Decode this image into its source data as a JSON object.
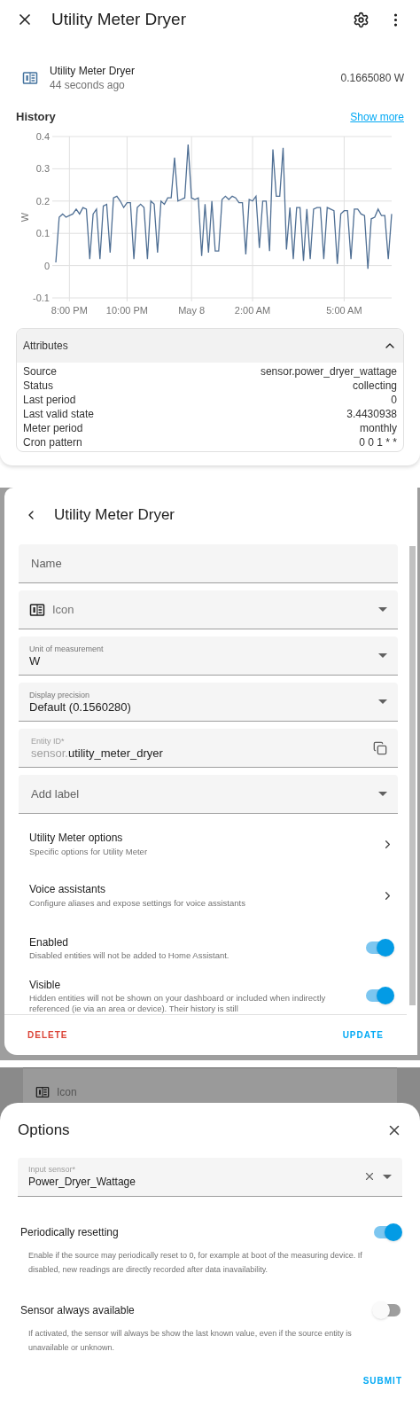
{
  "more_info": {
    "title": "Utility Meter Dryer",
    "entity": {
      "name": "Utility Meter Dryer",
      "last_changed": "44 seconds ago",
      "state": "0.1665080 W"
    },
    "history": {
      "title": "History",
      "show_more": "Show more",
      "chart_data": {
        "type": "line",
        "grid": true,
        "ylabel": "W",
        "ylim": [
          -0.1,
          0.4
        ],
        "yticks": [
          -0.1,
          0,
          0.1,
          0.2,
          0.3,
          0.4
        ],
        "categories": [
          null,
          null,
          null,
          null,
          "8:00 PM",
          null,
          null,
          null,
          null,
          null,
          null,
          null,
          null,
          null,
          null,
          null,
          null,
          null,
          null,
          null,
          null,
          "10:00 PM",
          null,
          null,
          null,
          null,
          null,
          null,
          null,
          null,
          null,
          null,
          null,
          null,
          null,
          null,
          null,
          null,
          null,
          null,
          "May 8",
          null,
          null,
          null,
          null,
          null,
          null,
          null,
          null,
          null,
          null,
          null,
          null,
          null,
          null,
          null,
          null,
          null,
          "2:00 AM",
          null,
          null,
          null,
          null,
          null,
          null,
          null,
          null,
          null,
          null,
          null,
          null,
          null,
          null,
          null,
          null,
          null,
          null,
          null,
          null,
          null,
          null,
          null,
          null,
          null,
          null,
          "5:00 AM",
          null,
          null,
          null,
          null,
          null,
          null,
          null,
          null,
          null,
          null,
          null,
          null,
          null,
          null
        ],
        "series": [
          {
            "color": "#4f6f94",
            "values": [
              0.01,
              0.15,
              0.16,
              0.15,
              0.155,
              0.16,
              0.175,
              0.16,
              0.18,
              0.175,
              0.02,
              0.16,
              0.175,
              0.02,
              0.185,
              0.19,
              0.04,
              0.21,
              0.215,
              0.2,
              0.18,
              0.195,
              0.195,
              0.02,
              0.18,
              0.19,
              0.18,
              0.02,
              0.2,
              0.19,
              0.04,
              0.2,
              0.19,
              0.21,
              0.21,
              0.335,
              0.2,
              0.205,
              0.21,
              0.375,
              0.21,
              0.205,
              0.21,
              0.03,
              0.19,
              0.04,
              0.2,
              0.045,
              0.045,
              0.205,
              0.215,
              0.205,
              0.215,
              0.21,
              0.195,
              0.195,
              0.035,
              0.205,
              0.2,
              0.215,
              0.055,
              0.2,
              0.2,
              0.045,
              0.36,
              0.215,
              0.215,
              0.365,
              0.05,
              0.18,
              0.02,
              0.18,
              0.18,
              0.015,
              0.175,
              0.02,
              0.175,
              0.18,
              0.18,
              0.02,
              0.18,
              0.175,
              0.17,
              0.005,
              0.16,
              0.17,
              0.17,
              0.02,
              0.175,
              0.175,
              0.16,
              0.155,
              -0.01,
              0.145,
              0.15,
              0.175,
              0.155,
              0.155,
              0.02,
              0.16
            ]
          }
        ]
      }
    },
    "attributes": {
      "title": "Attributes",
      "expanded": true,
      "rows": [
        {
          "name": "Source",
          "value": "sensor.power_dryer_wattage"
        },
        {
          "name": "Status",
          "value": "collecting"
        },
        {
          "name": "Last period",
          "value": "0"
        },
        {
          "name": "Last valid state",
          "value": "3.4430938"
        },
        {
          "name": "Meter period",
          "value": "monthly"
        },
        {
          "name": "Cron pattern",
          "value": "0 0 1 * *"
        }
      ]
    }
  },
  "settings": {
    "title": "Utility Meter Dryer",
    "fields": [
      {
        "kind": "text",
        "placeholder": "Name"
      },
      {
        "kind": "icon_select",
        "placeholder": "Icon"
      },
      {
        "kind": "select",
        "label": "Unit of measurement",
        "value": "W"
      },
      {
        "kind": "select",
        "label": "Display precision",
        "value": "Default (0.1560280)"
      },
      {
        "kind": "entity_id",
        "label": "Entity ID*",
        "prefix": "sensor.",
        "value": "utility_meter_dryer"
      },
      {
        "kind": "select",
        "placeholder": "Add label"
      }
    ],
    "links": [
      {
        "title": "Utility Meter options",
        "subtitle": "Specific options for Utility Meter"
      },
      {
        "title": "Voice assistants",
        "subtitle": "Configure aliases and expose settings for voice assistants"
      }
    ],
    "toggles": [
      {
        "title": "Enabled",
        "description": "Disabled entities will not be added to Home Assistant.",
        "on": true
      },
      {
        "title": "Visible",
        "description": "Hidden entities will not be shown on your dashboard or included when indirectly referenced (ie via an area or device). Their history is still",
        "on": true
      }
    ],
    "delete": "DELETE",
    "update": "UPDATE"
  },
  "backdrop": {
    "field_placeholder": "Icon"
  },
  "options": {
    "title": "Options",
    "input_sensor": {
      "label": "Input sensor*",
      "value": "Power_Dryer_Wattage"
    },
    "toggles": [
      {
        "title": "Periodically resetting",
        "description": "Enable if the source may periodically reset to 0, for example at boot of the measuring device. If disabled, new readings are directly recorded after data inavailability.",
        "on": true
      },
      {
        "title": "Sensor always available",
        "description": "If activated, the sensor will always be show the last known value, even if the source entity is unavailable or unknown.",
        "on": false
      }
    ],
    "submit": "SUBMIT"
  }
}
